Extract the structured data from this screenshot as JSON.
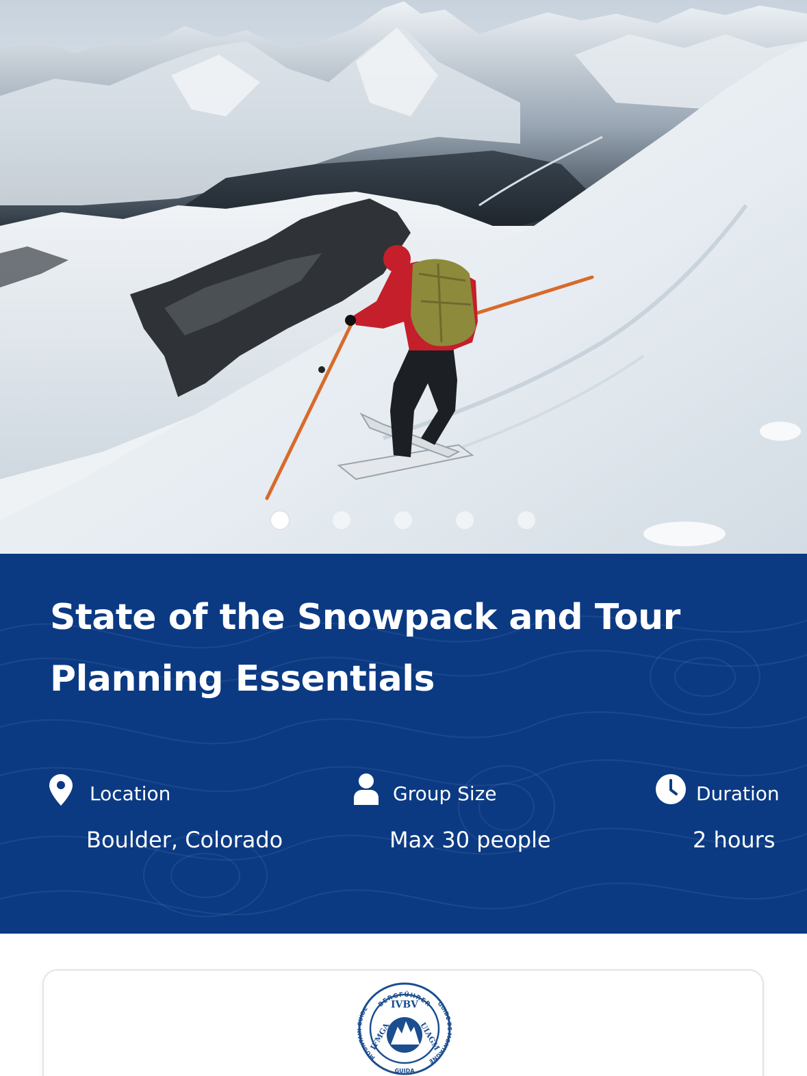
{
  "hero": {
    "image_alt": "Skier with red jacket and yellow backpack descending a steep snow slope with mountain peaks behind",
    "carousel": {
      "total": 5,
      "active_index": 0
    }
  },
  "info": {
    "title": "State of the Snowpack and Tour Planning Essentials",
    "location": {
      "label": "Location",
      "value": "Boulder, Colorado",
      "icon": "map-pin-icon"
    },
    "group_size": {
      "label": "Group Size",
      "value": "Max 30 people",
      "icon": "person-icon"
    },
    "duration": {
      "label": "Duration",
      "value": "2 hours",
      "icon": "clock-icon"
    }
  },
  "badge": {
    "top_text": "BERGFÜHRER",
    "center_top": "IVBV",
    "left_text": "MOUNTAIN GUIDE",
    "right_text": "GUIDE DE MONTAGNE",
    "bottom_text": "GUIDA",
    "center_left": "IFMGA",
    "center_right": "UIAGM"
  },
  "colors": {
    "panel_blue": "#0b3a83",
    "text_white": "#ffffff"
  }
}
